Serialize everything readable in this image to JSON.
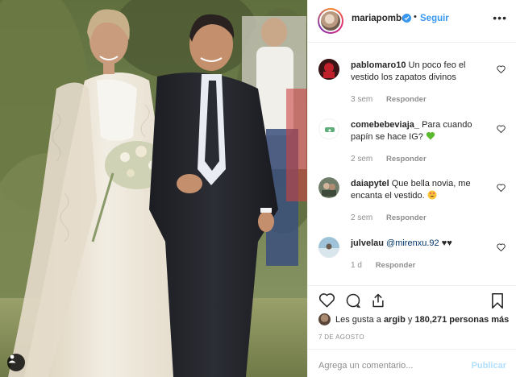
{
  "post": {
    "username": "mariapombo",
    "dot": "•",
    "follow_label": "Seguir",
    "more_label": "•••"
  },
  "comments": [
    {
      "user": "pablomaro10",
      "text": "Un poco feo el vestido los zapatos divinos",
      "time": "3 sem",
      "reply": "Responder",
      "avatar_color": "#c0202a"
    },
    {
      "user": "comebebeviaja_",
      "text": "Para cuando papín se hace IG?",
      "time": "2 sem",
      "reply": "Responder",
      "avatar_color": "#ffffff"
    },
    {
      "user": "daiapytel",
      "text": "Que bella novia, me encanta el vestido.",
      "time": "2 sem",
      "reply": "Responder",
      "avatar_color": "#6f7d6a"
    },
    {
      "user": "julvelau",
      "mention": "@mirenxu.92",
      "text": "♥♥",
      "time": "1 d",
      "reply": "Responder",
      "avatar_color": "#9ec3d8"
    }
  ],
  "likes": {
    "prefix": "Les gusta a",
    "user": "argib",
    "connector": "y",
    "count": "180,271 personas más"
  },
  "date": "7 DE AGOSTO",
  "add_comment": {
    "placeholder": "Agrega un comentario...",
    "publish_label": "Publicar"
  },
  "colors": {
    "accent": "#3897f0",
    "muted": "#8e8e8e",
    "mention": "#003569",
    "publish_disabled": "#b2dffc",
    "green_heart": "#5cb82e"
  },
  "icons": [
    "verified-badge-icon",
    "more-options-icon",
    "heart-icon",
    "comment-icon",
    "share-icon",
    "bookmark-icon",
    "user-tag-icon",
    "green-heart-emoji-icon",
    "heart-eyes-emoji-icon"
  ]
}
